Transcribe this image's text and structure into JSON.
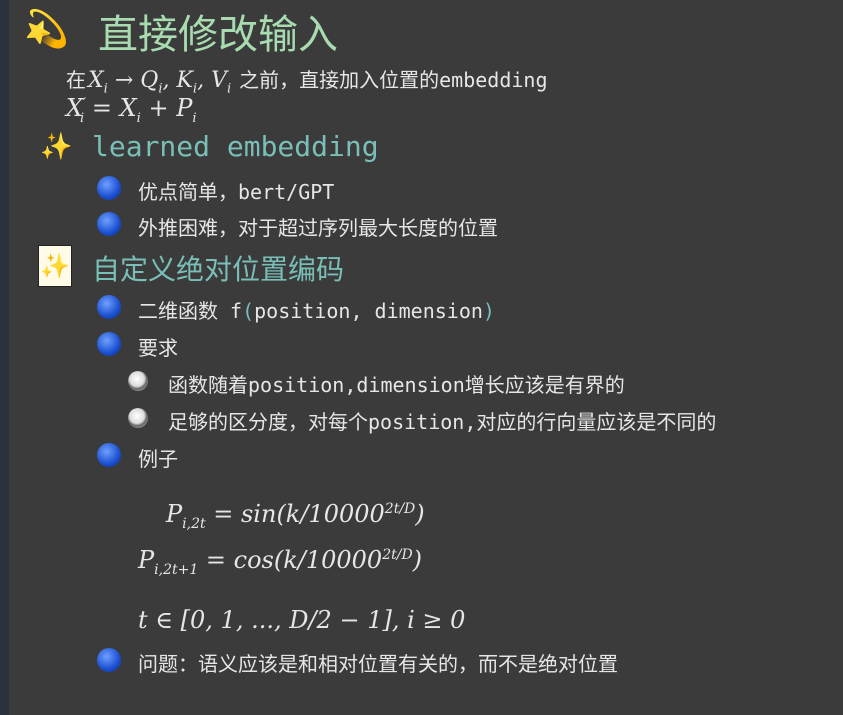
{
  "title": "直接修改输入",
  "intro": {
    "line1_prefix": "在",
    "line1_math": "Xᵢ → Qᵢ, Kᵢ, Vᵢ",
    "line1_suffix": "之前，直接加入位置的embedding",
    "line2_math": "X′ᵢ = Xᵢ + Pᵢ"
  },
  "section1": {
    "heading": "learned embedding",
    "items": [
      "优点简单，bert/GPT",
      "外推困难，对于超过序列最大长度的位置"
    ]
  },
  "section2": {
    "heading": "自定义绝对位置编码",
    "item1_prefix": "二维函数 f",
    "item1_open": "(",
    "item1_args": "position, dimension",
    "item1_close": ")",
    "item2": "要求",
    "subitems": [
      "函数随着position,dimension增长应该是有界的",
      "足够的区分度，对每个position,对应的行向量应该是不同的"
    ],
    "item3": "例子",
    "formulas": [
      "P_{i,2t} = sin(k/10000^{2t/D})",
      "P_{i,2t+1} = cos(k/10000^{2t/D})",
      "t ∈ [0, 1, ..., D/2 − 1], i ≥ 0"
    ],
    "item4": "问题：语义应该是和相对位置有关的，而不是绝对位置"
  }
}
